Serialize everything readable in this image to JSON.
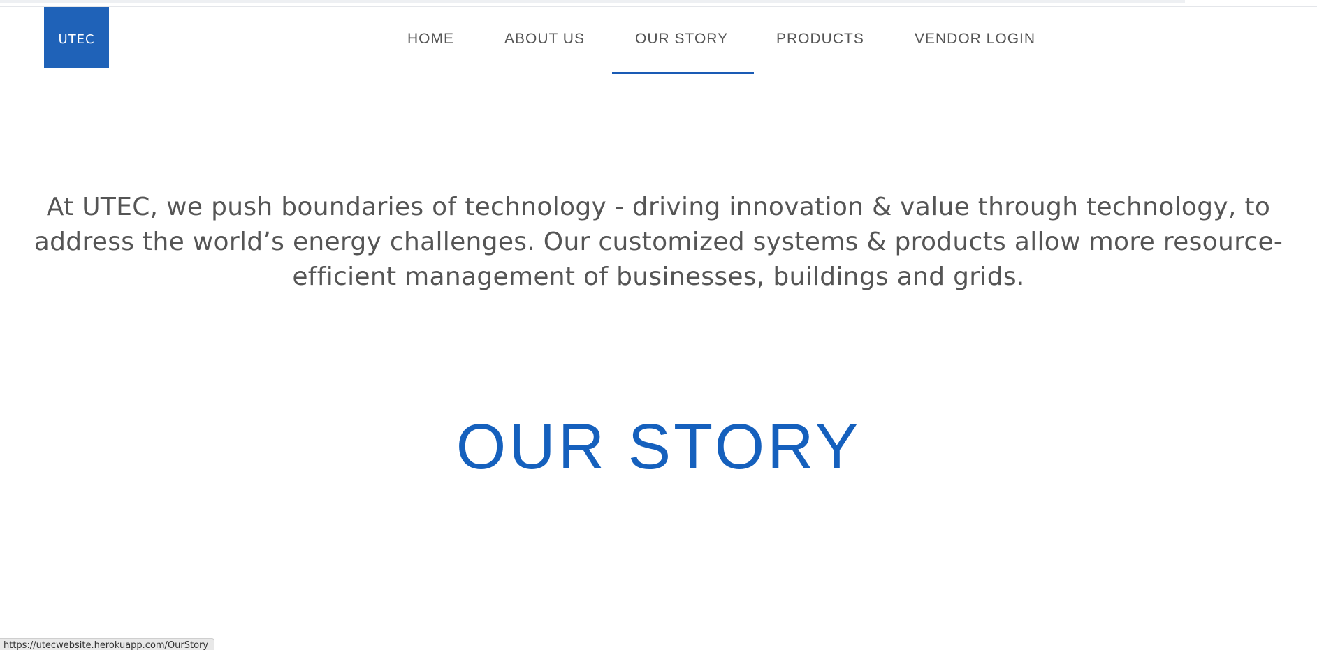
{
  "brand": {
    "logo_text": "UTEC",
    "logo_color": "#1f62b8"
  },
  "nav": {
    "items": [
      {
        "label": "HOME",
        "active": false
      },
      {
        "label": "ABOUT US",
        "active": false
      },
      {
        "label": "OUR STORY",
        "active": true
      },
      {
        "label": "PRODUCTS",
        "active": false
      },
      {
        "label": "VENDOR LOGIN",
        "active": false
      }
    ],
    "active_color": "#1a5bb5"
  },
  "intro": {
    "text": "At UTEC, we push boundaries of technology - driving innovation & value through technology, to address the world’s energy challenges. Our customized systems & products allow more resource-efficient management of businesses, buildings and grids."
  },
  "section": {
    "heading": "OUR STORY",
    "heading_color": "#1560bd"
  },
  "status_bar": {
    "url": "https://utecwebsite.herokuapp.com/OurStory"
  }
}
